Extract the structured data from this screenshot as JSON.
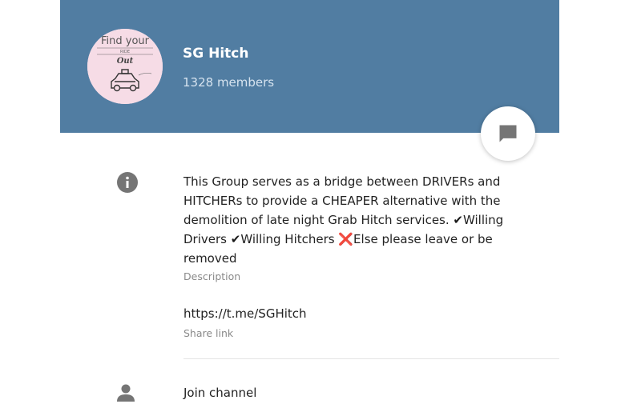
{
  "group": {
    "name": "SG Hitch",
    "members": "1328 members",
    "avatar_text": [
      "Find your",
      "RIDE",
      "Out"
    ]
  },
  "about": {
    "desc_part1": "This Group serves as a bridge between DRIVERs and HITCHERs to provide a CHEAPER alternative with the demolition of late night Grab Hitch services. ",
    "mark_check_1": "✔",
    "desc_part2": "Willing Drivers ",
    "mark_check_2": "✔",
    "desc_part3": "Willing Hitchers ",
    "mark_cross": "❌",
    "desc_part4": "Else please leave or be removed",
    "description_label": "Description",
    "link": "https://t.me/SGHitch",
    "link_label": "Share link"
  },
  "actions": {
    "join_label": "Join channel"
  },
  "icons": {
    "message": "message-icon",
    "info": "info-icon",
    "person": "person-icon"
  },
  "colors": {
    "header": "#517da2",
    "icon_gray": "#757575"
  }
}
